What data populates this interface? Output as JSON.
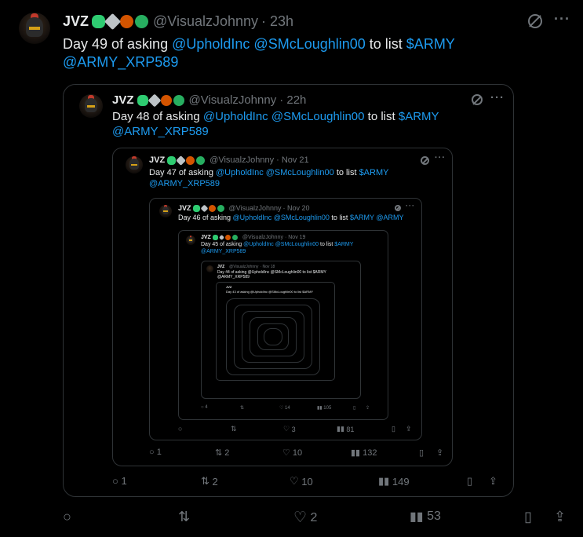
{
  "tweet": {
    "name": "JVZ",
    "handle": "@VisualzJohnny",
    "time": "· 23h",
    "text_prefix": "Day 49 of asking ",
    "mention1": "@UpholdInc",
    "mention2": "@SMcLoughlin00",
    "text_mid": " to list ",
    "cashtag": "$ARMY",
    "mention3": "@ARMY_XRP589",
    "replies": "",
    "retweets": "",
    "likes": "2",
    "views": "53"
  },
  "quote1": {
    "name": "JVZ",
    "handle": "@VisualzJohnny",
    "time": "· 22h",
    "text_prefix": "Day 48 of asking ",
    "mention1": "@UpholdInc",
    "mention2": "@SMcLoughlin00",
    "text_mid": " to list ",
    "cashtag": "$ARMY",
    "mention3": "@ARMY_XRP589",
    "replies": "1",
    "retweets": "2",
    "likes": "10",
    "views": "149"
  },
  "quote2": {
    "name": "JVZ",
    "handle": "@VisualzJohnny",
    "time": "· Nov 21",
    "text_prefix": "Day 47 of asking ",
    "mention1": "@UpholdInc",
    "mention2": "@SMcLoughlin00",
    "text_mid": " to list ",
    "cashtag": "$ARMY",
    "mention3": "@ARMY_XRP589",
    "replies": "1",
    "retweets": "2",
    "likes": "10",
    "views": "132"
  },
  "quote3": {
    "name": "JVZ",
    "handle": "@VisualzJohnny",
    "time": "· Nov 20",
    "text_prefix": "Day 46 of asking ",
    "mention1": "@UpholdInc",
    "mention2": "@SMcLoughlin00",
    "text_mid": " to list ",
    "cashtag": "$ARMY",
    "mention3": "@ARMY",
    "replies": "",
    "retweets": "",
    "likes": "3",
    "views": "81"
  },
  "quote4": {
    "name": "JVZ",
    "handle": "@VisualzJohnny",
    "time": "· Nov 19",
    "text_prefix": "Day 45 of asking ",
    "mention1": "@UpholdInc",
    "mention2": "@SMcLoughlin00",
    "text_mid": " to list ",
    "cashtag": "$ARMY",
    "mention3": "@ARMY_XRP589",
    "replies": "4",
    "retweets": "",
    "likes": "14",
    "views": "105"
  },
  "quote5": {
    "name": "JVZ",
    "handle": "@VisualzJohnny",
    "time": "· Nov 18",
    "text": "Day 44 of asking @UpholdInc @SMcLoughlin00 to list $ARMY @ARMY_XRP589"
  },
  "quote6": {
    "name": "JVZ",
    "text": "Day 43 of asking @UpholdInc @SMcLoughlin00 to list $ARMY"
  },
  "colors": {
    "accent": "#1d9bf0",
    "muted": "#71767b",
    "border": "#2f3336",
    "bg": "#000000"
  }
}
